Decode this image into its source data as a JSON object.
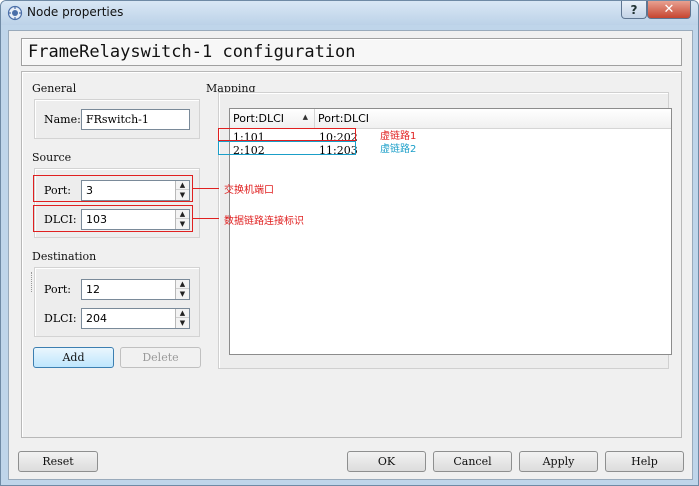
{
  "window": {
    "title": "Node properties",
    "help_glyph": "?",
    "close_glyph": "✕"
  },
  "config_title": "FrameRelayswitch-1 configuration",
  "general": {
    "label": "General",
    "name_label": "Name:",
    "name_value": "FRswitch-1"
  },
  "source": {
    "label": "Source",
    "port_label": "Port:",
    "port_value": "3",
    "dlci_label": "DLCI:",
    "dlci_value": "103"
  },
  "destination": {
    "label": "Destination",
    "port_label": "Port:",
    "port_value": "12",
    "dlci_label": "DLCI:",
    "dlci_value": "204"
  },
  "buttons": {
    "add": "Add",
    "delete": "Delete",
    "reset": "Reset",
    "ok": "OK",
    "cancel": "Cancel",
    "apply": "Apply",
    "help": "Help"
  },
  "mapping": {
    "label": "Mapping",
    "columns": [
      "Port:DLCI",
      "Port:DLCI"
    ],
    "rows": [
      {
        "src": "1:101",
        "dst": "10:202"
      },
      {
        "src": "2:102",
        "dst": "11:203"
      }
    ]
  },
  "annotations": {
    "vc1": "虚链路1",
    "vc2": "虚链路2",
    "switch_port": "交换机端口",
    "dlci_id": "数据链路连接标识"
  },
  "colors": {
    "annotation_red": "#e02020",
    "annotation_teal": "#1a9ec8"
  }
}
